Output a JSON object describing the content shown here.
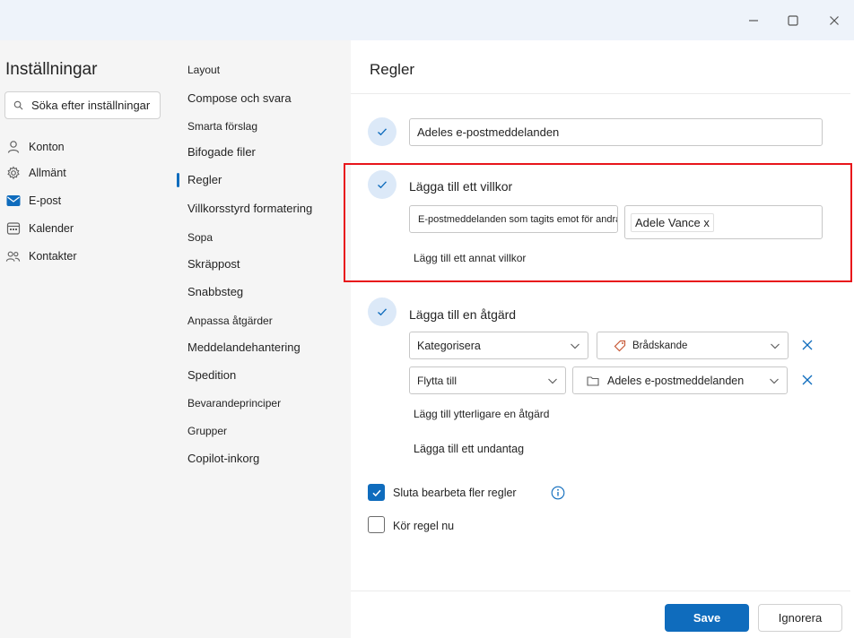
{
  "window": {
    "minimize_icon": "minimize-icon",
    "maximize_icon": "maximize-icon",
    "close_icon": "close-icon"
  },
  "sidebar": {
    "title": "Inställningar",
    "search_placeholder": "Söka efter inställningar",
    "items": [
      {
        "label": "Konton",
        "icon": "person-icon"
      },
      {
        "label": "Allmänt",
        "icon": "gear-icon"
      },
      {
        "label": "E-post",
        "icon": "mail-icon",
        "active": true
      },
      {
        "label": "Kalender",
        "icon": "calendar-icon"
      },
      {
        "label": "Kontakter",
        "icon": "people-icon"
      }
    ]
  },
  "subnav": {
    "items": [
      "Layout",
      "Compose och svara",
      "Smarta förslag",
      "Bifogade filer",
      "Regler",
      "Villkorsstyrd formatering",
      "Sopa",
      "Skräppost",
      "Snabbsteg",
      "Anpassa åtgärder",
      "Meddelandehantering",
      "Spedition",
      "Bevarandeprinciper",
      "Grupper",
      "Copilot-inkorg"
    ],
    "active": "Regler"
  },
  "main": {
    "title": "Regler",
    "rule_name": "Adeles e-postmeddelanden",
    "condition": {
      "label": "Lägga till ett villkor",
      "condition_type": "E-postmeddelanden som tagits emot för andra",
      "recipient_chip": "Adele Vance x",
      "add_more": "Lägg till ett annat villkor"
    },
    "action": {
      "label": "Lägga till en åtgärd",
      "rows": [
        {
          "type": "Kategorisera",
          "value": "Brådskande",
          "value_icon": "tag-icon"
        },
        {
          "type": "Flytta till",
          "value": "Adeles e-postmeddelanden",
          "value_icon": "folder-icon"
        }
      ],
      "add_more": "Lägg till ytterligare en åtgärd"
    },
    "exception": "Lägga till ett undantag",
    "stop_processing": {
      "label": "Sluta bearbeta fler regler",
      "checked": true
    },
    "run_now": {
      "label": "Kör regel nu",
      "checked": false
    }
  },
  "footer": {
    "save": "Save",
    "discard": "Ignorera"
  },
  "colors": {
    "accent": "#0f6cbd",
    "highlight": "#e8151b",
    "titlebar": "#eef3fa",
    "sidebar_bg": "#f5f5f5"
  }
}
